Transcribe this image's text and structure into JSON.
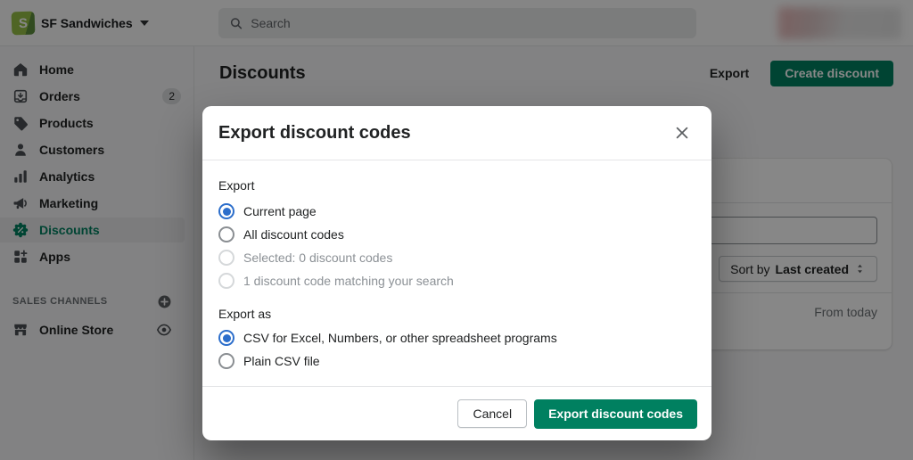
{
  "topbar": {
    "store_name": "SF Sandwiches",
    "search_placeholder": "Search"
  },
  "sidebar": {
    "items": [
      {
        "label": "Home",
        "icon": "home-icon"
      },
      {
        "label": "Orders",
        "icon": "orders-icon",
        "badge": "2"
      },
      {
        "label": "Products",
        "icon": "products-icon"
      },
      {
        "label": "Customers",
        "icon": "customers-icon"
      },
      {
        "label": "Analytics",
        "icon": "analytics-icon"
      },
      {
        "label": "Marketing",
        "icon": "marketing-icon"
      },
      {
        "label": "Discounts",
        "icon": "discounts-icon",
        "selected": true
      },
      {
        "label": "Apps",
        "icon": "apps-icon"
      }
    ],
    "sales_channels_label": "SALES CHANNELS",
    "channels": [
      {
        "label": "Online Store",
        "icon": "storefront-icon"
      }
    ]
  },
  "page": {
    "title": "Discounts",
    "export_button": "Export",
    "create_button": "Create discount",
    "sort_button_prefix": "Sort by",
    "sort_button_value": "Last created",
    "row_status": "From today",
    "filter_input_value": ""
  },
  "modal": {
    "title": "Export discount codes",
    "export_section_label": "Export",
    "export_options": [
      {
        "label": "Current page",
        "state": "selected"
      },
      {
        "label": "All discount codes",
        "state": "unselected"
      },
      {
        "label": "Selected: 0 discount codes",
        "state": "disabled"
      },
      {
        "label": "1 discount code matching your search",
        "state": "disabled"
      }
    ],
    "export_as_label": "Export as",
    "format_options": [
      {
        "label": "CSV for Excel, Numbers, or other spreadsheet programs",
        "state": "selected"
      },
      {
        "label": "Plain CSV file",
        "state": "unselected"
      }
    ],
    "cancel_button": "Cancel",
    "submit_button": "Export discount codes"
  },
  "colors": {
    "primary_green": "#008060",
    "radio_selected_blue": "#2c6ecb",
    "selected_nav_green": "#008060",
    "logo_green": "#95bf47",
    "overlay": "rgba(0,0,0,0.47)"
  }
}
